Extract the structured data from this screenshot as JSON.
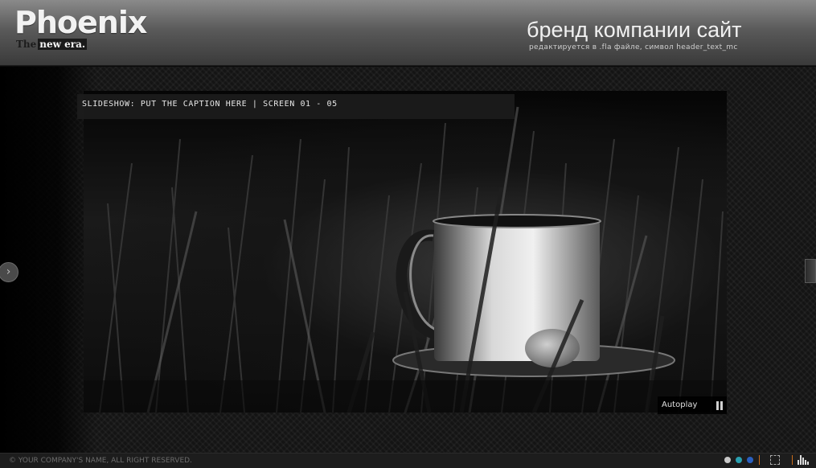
{
  "header": {
    "logo": "Phoenix",
    "tagline_the": "The",
    "tagline_era": "new era.",
    "brand_title": "бренд компании  сайт",
    "brand_subtitle": "редактируется в .fla файле,  символ header_text_mc"
  },
  "slideshow": {
    "caption": "SLIDESHOW: PUT THE CAPTION HERE  |  SCREEN 01 - 05",
    "autoplay_label": "Autoplay"
  },
  "footer": {
    "copyright": "© YOUR COMPANY'S NAME, ALL RIGHT RESERVED.",
    "theme_colors": [
      "#c8c8c8",
      "#2aa0b0",
      "#2a60c0"
    ]
  },
  "icons": {
    "next": "chevron-right-icon",
    "pause": "pause-icon",
    "fullscreen": "fullscreen-icon",
    "music": "sound-bars-icon"
  }
}
